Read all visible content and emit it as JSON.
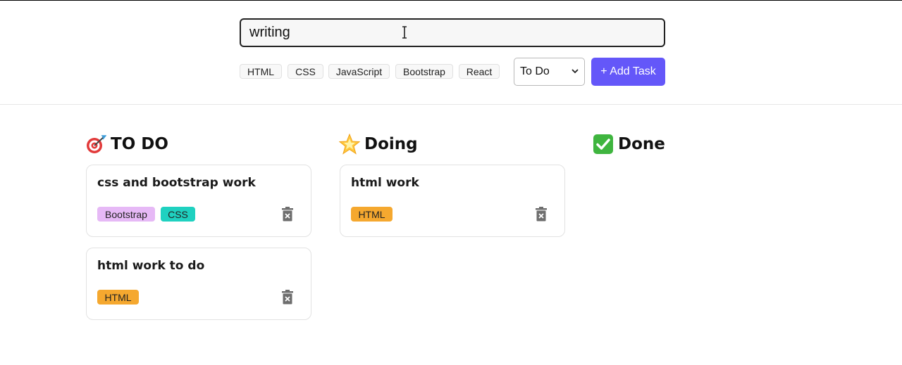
{
  "form": {
    "input_value": "writing ",
    "tags": [
      "HTML",
      "CSS",
      "JavaScript",
      "Bootstrap",
      "React"
    ],
    "status_selected": "To Do",
    "add_button_label": "+ Add Task"
  },
  "columns": [
    {
      "icon": "dart-target-icon",
      "emoji": "🎯",
      "title": "TO DO",
      "cards": [
        {
          "title": "css and bootstrap work",
          "tags": [
            "Bootstrap",
            "CSS"
          ]
        },
        {
          "title": "html work to do",
          "tags": [
            "HTML"
          ]
        }
      ]
    },
    {
      "icon": "glowing-star-icon",
      "emoji": "🌟",
      "title": "Doing",
      "cards": [
        {
          "title": "html work",
          "tags": [
            "HTML"
          ]
        }
      ]
    },
    {
      "icon": "check-mark-icon",
      "emoji": "✅",
      "title": "Done",
      "cards": []
    }
  ],
  "colors": {
    "accent": "#6457f9",
    "tag_bootstrap": "#e6b9f6",
    "tag_css": "#1fd1c0",
    "tag_html": "#f5a82f"
  }
}
